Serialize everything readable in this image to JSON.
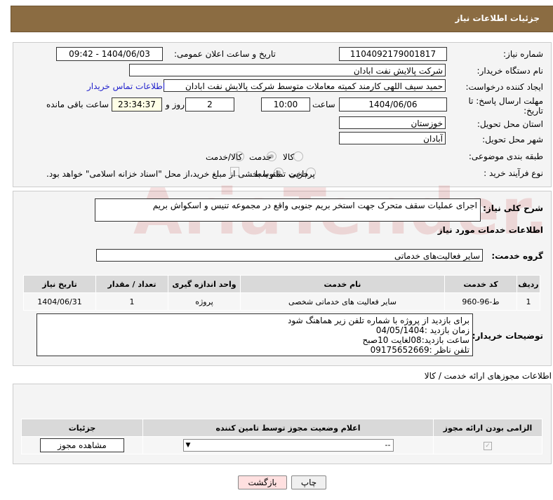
{
  "header": {
    "title": "جزئیات اطلاعات نیاز"
  },
  "fields": {
    "need_number_label": "شماره نیاز:",
    "need_number": "1104092179001817",
    "announce_label": "تاریخ و ساعت اعلان عمومی:",
    "announce_value": "1404/06/03 - 09:42",
    "buyer_label": "نام دستگاه خریدار:",
    "buyer": "شرکت پالایش نفت ابادان",
    "creator_label": "ایجاد کننده درخواست:",
    "creator": "حمید سیف اللهی کارمند کمیته معاملات متوسط  شرکت پالایش نفت ابادان",
    "contact_link": "اطلاعات تماس خریدار",
    "deadline_label": "مهلت ارسال پاسخ: تا تاریخ:",
    "deadline_date": "1404/06/06",
    "time_label": "ساعت",
    "deadline_time": "10:00",
    "days": "2",
    "days_label": "روز و",
    "remaining": "23:34:37",
    "remaining_label": "ساعت باقی مانده",
    "province_label": "استان محل تحویل:",
    "province": "خوزستان",
    "city_label": "شهر محل تحویل:",
    "city": "آبادان",
    "category_label": "طبقه بندی موضوعی:",
    "category_options": [
      "کالا",
      "خدمت",
      "کالا/خدمت"
    ],
    "category_selected": "خدمت",
    "process_label": "نوع فرآیند خرید :",
    "process_options": [
      "جزیی",
      "متوسط"
    ],
    "process_selected": "متوسط",
    "payment_note": "پرداخت تمام یا بخشی از مبلغ خرید،از محل \"اسناد خزانه اسلامی\" خواهد بود."
  },
  "description": {
    "label": "شرح کلی نیاز:",
    "value": "اجرای عملیات سقف متحرک جهت استخر بریم جنوبی واقع در مجموعه  تنیس و اسکواش بریم"
  },
  "services": {
    "title": "اطلاعات خدمات مورد نیاز",
    "group_label": "گروه خدمت:",
    "group": "سایر فعالیت‌های خدماتی",
    "columns": [
      "ردیف",
      "کد خدمت",
      "نام خدمت",
      "واحد اندازه گیری",
      "تعداد / مقدار",
      "تاریخ نیاز"
    ],
    "rows": [
      [
        "1",
        "ط-96-960",
        "سایر فعالیت های خدماتی شخصی",
        "پروژه",
        "1",
        "1404/06/31"
      ]
    ]
  },
  "buyer_notes": {
    "label": "توضیحات خریدار:",
    "value": "برای بازدید از پروژه با شماره تلفن زیر هماهنگ شود\nزمان بازدید :04/05/1404\nساعت بازدید:08لغایت 10صبح\nتلفن ناظر :09175652669"
  },
  "permits": {
    "title": "اطلاعات مجوزهای ارائه خدمت / کالا",
    "columns": [
      "الزامی بودن ارائه مجوز",
      "اعلام وضعیت مجوز توسط تامین کننده",
      "جزئیات"
    ],
    "select_value": "--",
    "view_button": "مشاهده مجوز"
  },
  "buttons": {
    "print": "چاپ",
    "back": "بازگشت"
  },
  "watermark": "AriaTender.neT"
}
